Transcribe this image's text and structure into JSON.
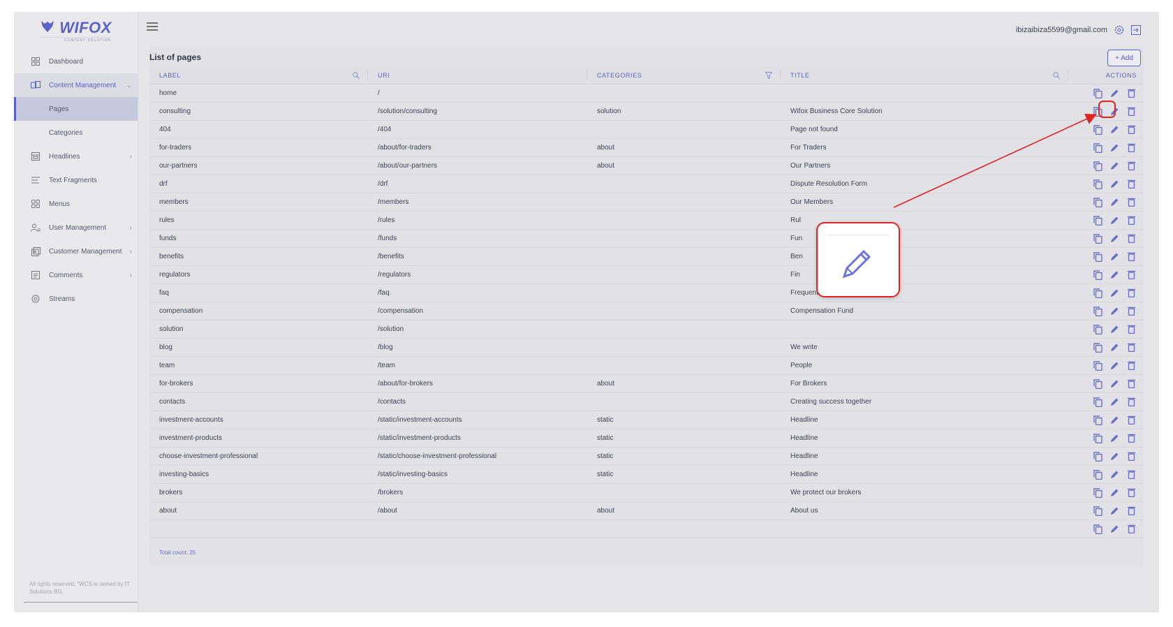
{
  "brand": {
    "name": "WIFOX",
    "tagline": "CONTENT SOLUTION"
  },
  "sidebar": {
    "items": [
      {
        "label": "Dashboard",
        "icon": "dashboard-icon"
      },
      {
        "label": "Content Management",
        "icon": "content-management-icon"
      },
      {
        "label": "Pages"
      },
      {
        "label": "Categories"
      },
      {
        "label": "Headlines",
        "icon": "headlines-icon"
      },
      {
        "label": "Text Fragments",
        "icon": "text-fragments-icon"
      },
      {
        "label": "Menus",
        "icon": "menus-icon"
      },
      {
        "label": "User Management",
        "icon": "user-management-icon"
      },
      {
        "label": "Customer Management",
        "icon": "customer-management-icon"
      },
      {
        "label": "Comments",
        "icon": "comments-icon"
      },
      {
        "label": "Streams",
        "icon": "streams-icon"
      }
    ],
    "footer": "All rights reserved. \"WCS is owned by IT Solutions BG."
  },
  "topbar": {
    "user_email": "ibizaibiza5599@gmail.com"
  },
  "page": {
    "title": "List of pages",
    "add_label": "+ Add"
  },
  "table": {
    "headers": {
      "label": "LABEL",
      "uri": "URI",
      "categories": "CATEGORIES",
      "title": "TITLE",
      "actions": "ACTIONS"
    },
    "rows": [
      {
        "label": "home",
        "uri": "/",
        "category": "",
        "title": ""
      },
      {
        "label": "consulting",
        "uri": "/solution/consulting",
        "category": "solution",
        "title": "Wifox Business Core Solution"
      },
      {
        "label": "404",
        "uri": "/404",
        "category": "",
        "title": "Page not found"
      },
      {
        "label": "for-traders",
        "uri": "/about/for-traders",
        "category": "about",
        "title": "For Traders"
      },
      {
        "label": "our-partners",
        "uri": "/about/our-partners",
        "category": "about",
        "title": "Our Partners"
      },
      {
        "label": "drf",
        "uri": "/drf",
        "category": "",
        "title": "Dispute Resolution Form"
      },
      {
        "label": "members",
        "uri": "/members",
        "category": "",
        "title": "Our Members"
      },
      {
        "label": "rules",
        "uri": "/rules",
        "category": "",
        "title": "Rul"
      },
      {
        "label": "funds",
        "uri": "/funds",
        "category": "",
        "title": "Fun"
      },
      {
        "label": "benefits",
        "uri": "/benefits",
        "category": "",
        "title": "Ben"
      },
      {
        "label": "regulators",
        "uri": "/regulators",
        "category": "",
        "title": "Fin"
      },
      {
        "label": "faq",
        "uri": "/faq",
        "category": "",
        "title": "Frequently Asked Questions"
      },
      {
        "label": "compensation",
        "uri": "/compensation",
        "category": "",
        "title": "Compensation Fund"
      },
      {
        "label": "solution",
        "uri": "/solution",
        "category": "",
        "title": ""
      },
      {
        "label": "blog",
        "uri": "/blog",
        "category": "",
        "title": "We write"
      },
      {
        "label": "team",
        "uri": "/team",
        "category": "",
        "title": "People"
      },
      {
        "label": "for-brokers",
        "uri": "/about/for-brokers",
        "category": "about",
        "title": "For Brokers"
      },
      {
        "label": "contacts",
        "uri": "/contacts",
        "category": "",
        "title": "Creating success together"
      },
      {
        "label": "investment-accounts",
        "uri": "/static/investment-accounts",
        "category": "static",
        "title": "Headline"
      },
      {
        "label": "investment-products",
        "uri": "/static/investment-products",
        "category": "static",
        "title": "Headline"
      },
      {
        "label": "choose-investment-professional",
        "uri": "/static/choose-investment-professional",
        "category": "static",
        "title": "Headline"
      },
      {
        "label": "investing-basics",
        "uri": "/static/investing-basics",
        "category": "static",
        "title": "Headline"
      },
      {
        "label": "brokers",
        "uri": "/brokers",
        "category": "",
        "title": "We protect our brokers"
      },
      {
        "label": "about",
        "uri": "/about",
        "category": "about",
        "title": "About us"
      },
      {
        "label": "",
        "uri": "",
        "category": "",
        "title": ""
      }
    ],
    "total_count": "Total count: 25"
  },
  "colors": {
    "accent": "#5b63c8",
    "highlight": "#e02424"
  }
}
